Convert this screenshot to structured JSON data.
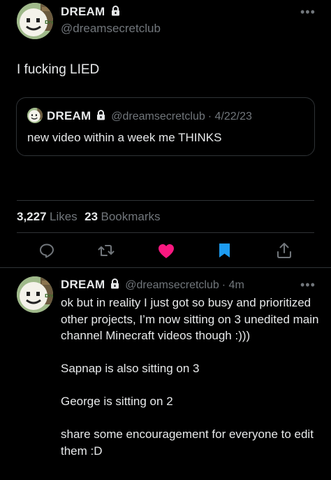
{
  "main_tweet": {
    "author_name": "DREAM",
    "author_handle": "@dreamsecretclub",
    "text": "I fucking LIED",
    "quoted": {
      "author_name": "DREAM",
      "author_handle": "@dreamsecretclub",
      "date": "· 4/22/23",
      "text": "new video within a week me THINKS"
    },
    "stats": {
      "likes_count": "3,227",
      "likes_label": "Likes",
      "bookmarks_count": "23",
      "bookmarks_label": "Bookmarks"
    },
    "actions": [
      "reply-icon",
      "retweet-icon",
      "heart-icon",
      "bookmark-icon",
      "share-icon"
    ]
  },
  "reply_tweet": {
    "author_name": "DREAM",
    "author_handle": "@dreamsecretclub",
    "time": "· 4m",
    "paragraphs": [
      "ok but in reality I just got so busy and prioritized other projects, I’m now sitting on 3 unedited main channel Minecraft videos though :)))",
      "Sapnap is also sitting on 3",
      "George is sitting on 2",
      "share some encouragement for everyone to edit them :D"
    ]
  },
  "avatar_text": "Dream",
  "colors": {
    "background": "#000000",
    "text": "#e7e9ea",
    "muted": "#71767b",
    "border": "#2f3336",
    "heart": "#f91880",
    "bookmark": "#1d9bf0"
  }
}
